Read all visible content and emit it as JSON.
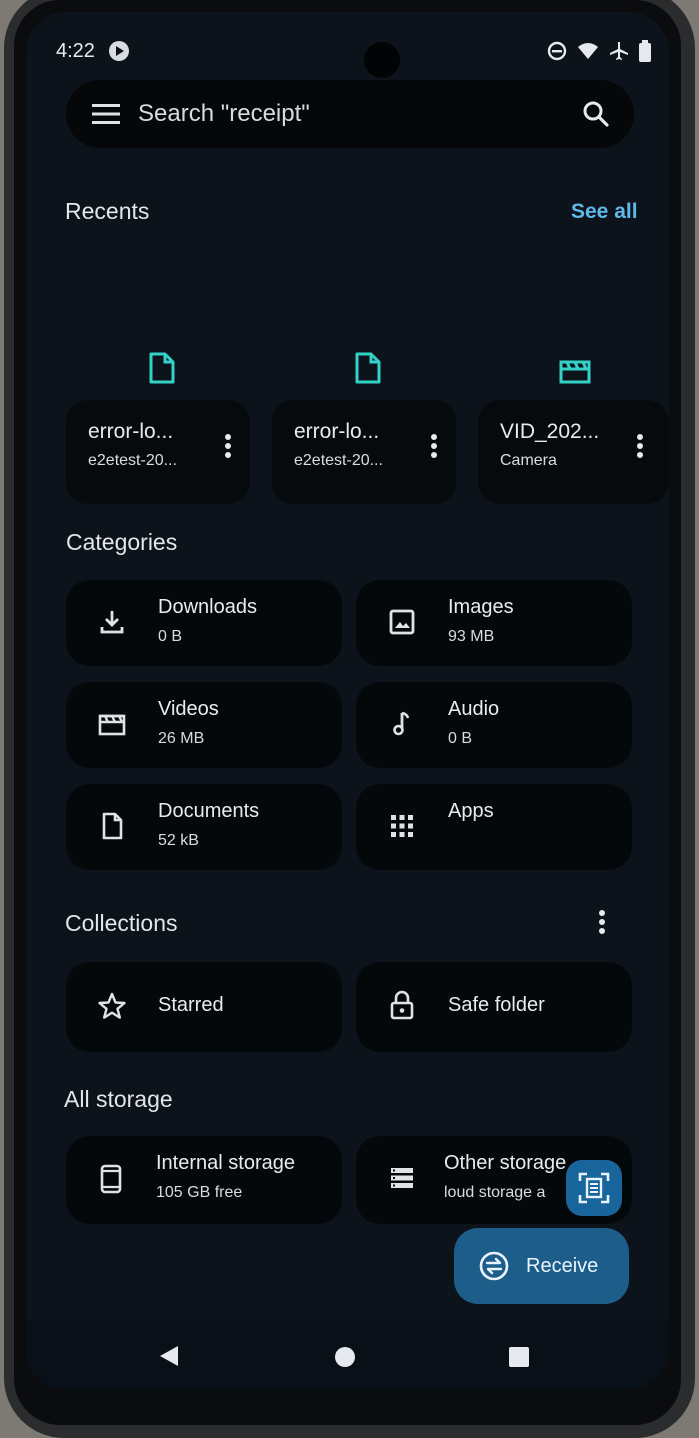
{
  "status_bar": {
    "time": "4:22"
  },
  "search": {
    "placeholder": "Search \"receipt\""
  },
  "recents": {
    "title": "Recents",
    "see_all": "See all",
    "items": [
      {
        "name": "error-lo...",
        "sub": "e2etest-20...",
        "icon": "file-icon"
      },
      {
        "name": "error-lo...",
        "sub": "e2etest-20...",
        "icon": "file-icon"
      },
      {
        "name": "VID_202...",
        "sub": "Camera",
        "icon": "video-icon"
      }
    ]
  },
  "categories": {
    "title": "Categories",
    "items": [
      {
        "label": "Downloads",
        "size": "0 B",
        "icon": "download-icon"
      },
      {
        "label": "Images",
        "size": "93 MB",
        "icon": "image-icon"
      },
      {
        "label": "Videos",
        "size": "26 MB",
        "icon": "video-icon"
      },
      {
        "label": "Audio",
        "size": "0 B",
        "icon": "music-note-icon"
      },
      {
        "label": "Documents",
        "size": "52 kB",
        "icon": "document-icon"
      },
      {
        "label": "Apps",
        "icon": "apps-grid-icon"
      }
    ]
  },
  "collections": {
    "title": "Collections",
    "items": [
      {
        "label": "Starred",
        "icon": "star-icon"
      },
      {
        "label": "Safe folder",
        "icon": "lock-icon"
      }
    ]
  },
  "all_storage": {
    "title": "All storage",
    "items": [
      {
        "label": "Internal storage",
        "sub": "105 GB free",
        "icon": "phone-icon"
      },
      {
        "label": "Other storage",
        "sub": "loud storage a",
        "icon": "storage-list-icon"
      }
    ]
  },
  "fab": {
    "label": "Receive"
  },
  "colors": {
    "accent": "#5fb8e8",
    "teal_icon": "#33d1c8",
    "fab": "#1d5d8a"
  }
}
